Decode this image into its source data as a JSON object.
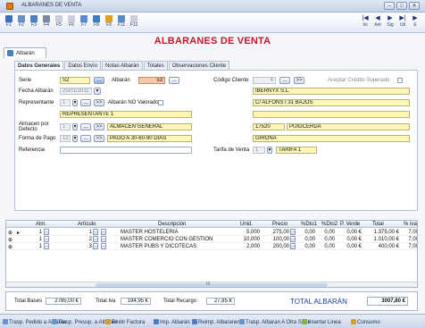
{
  "window": {
    "title": "ALBARANES DE VENTA",
    "controls": [
      "–",
      "□",
      "✕"
    ]
  },
  "toolbar": {
    "buttons": [
      {
        "label": "F1",
        "color": "#3a6fc4",
        "icon": "help-icon"
      },
      {
        "label": "F2",
        "color": "#6b8fc8",
        "icon": "new-document-icon"
      },
      {
        "label": "F3",
        "color": "#4f7ec4",
        "icon": "edit-icon"
      },
      {
        "label": "F4",
        "color": "#7a8aa8",
        "icon": "delete-icon"
      },
      {
        "label": "F5",
        "color": "#c8cfdb",
        "icon": "copy-icon"
      },
      {
        "label": "F6",
        "color": "#c8cfdb",
        "icon": "paste-icon"
      },
      {
        "label": "F7",
        "color": "#5a8bd0",
        "icon": "save-icon"
      },
      {
        "label": "F8",
        "color": "#3a7fc4",
        "icon": "print-icon"
      },
      {
        "label": "F9",
        "color": "#e0a020",
        "icon": "search-icon"
      },
      {
        "label": "F11",
        "color": "#5c8ac8",
        "icon": "filter-icon"
      },
      {
        "label": "F12",
        "color": "#c8cfdb",
        "icon": "exit-icon"
      }
    ],
    "nav": [
      {
        "glyph": "|◀",
        "label": "Ini"
      },
      {
        "glyph": "◀",
        "label": "Ant"
      },
      {
        "glyph": "▶",
        "label": "Sig"
      },
      {
        "glyph": "▶|",
        "label": "Ult"
      },
      {
        "glyph": "▶",
        "label": "E"
      }
    ]
  },
  "page_title": "ALBARANES DE VENTA",
  "doc_tab": "Albarán",
  "tabs": [
    "Datos Generales",
    "Datos Envío",
    "Notas Albarán",
    "Totales",
    "Observaciones Cliente"
  ],
  "form": {
    "serie_label": "Serie",
    "serie": "S2",
    "serie_btn": "...",
    "albaran_label": "Albarán",
    "albaran": "53",
    "albaran_btn": "...",
    "fecha_label": "Fecha Albarán",
    "fecha": "25/01/2011",
    "representante_label": "Representante",
    "representante": "1",
    "rep_btn": "...",
    "rep_go": ">>",
    "no_valorado_label": "Albarán NO Valorado",
    "representante_name": "REPRESENTANTE 1",
    "almacen_label": "Almacen por Defecto",
    "almacen": "1",
    "almacen_btn": "...",
    "almacen_go": ">>",
    "almacen_name": "ALMACEN GENERAL",
    "forma_pago_label": "Forma de Pago",
    "forma_pago": "12",
    "fp_btn": "...",
    "fp_go": ">>",
    "forma_pago_name": "PAGO A 30-60-90 DIAS",
    "referencia_label": "Referencia",
    "referencia": "",
    "codigo_cliente_label": "Código Cliente",
    "codigo_cliente": "4",
    "cc_btn": "...",
    "cc_go": ">>",
    "credito_label": "Aceptar Crédito Superado",
    "cliente_nombre": "IBERNYX S.L.",
    "cliente_direccion": "C/ ALFONS I 31 BAJOS",
    "cliente_extra": "",
    "cliente_cp": "17520",
    "cliente_poblacion": "PUIGCERDA",
    "cliente_provincia": "GIRONA",
    "tarifa_label": "Tarifa de Venta",
    "tarifa": "1",
    "tarifa_name": "TARIFA 1"
  },
  "grid": {
    "headers": [
      "Alm.",
      "Artículo",
      "Descripción",
      "Unid.",
      "Precio",
      "%Dto1",
      "%Dto2",
      "P. Verde",
      "Total",
      "% Iva"
    ],
    "rows": [
      {
        "alm": "1",
        "articulo": "1",
        "descripcion": "MASTER HOSTELERIA",
        "unid": "5,000",
        "precio": "275,00 €",
        "dto1": "0,00",
        "dto2": "0,00",
        "pverde": "0,00 €",
        "total": "1.375,00 €",
        "iva": "7,00"
      },
      {
        "alm": "1",
        "articulo": "2",
        "descripcion": "MASTER COMERCIO CON GESTION",
        "unid": "10,000",
        "precio": "100,00 €",
        "dto1": "0,00",
        "dto2": "0,00",
        "pverde": "0,00 €",
        "total": "1.010,00 €",
        "iva": "7,00"
      },
      {
        "alm": "1",
        "articulo": "3",
        "descripcion": "MASTER PUBS Y DICOTECAS",
        "unid": "2,000",
        "precio": "200,00 €",
        "dto1": "0,00",
        "dto2": "0,00",
        "pverde": "0,00 €",
        "total": "400,00 €",
        "iva": "7,00"
      }
    ],
    "scroll_marker": "III"
  },
  "totals": {
    "bases_label": "Total Bases",
    "bases": "2785,00 €",
    "iva_label": "Total Iva",
    "iva": "194,95 €",
    "recargo_label": "Total Recargo",
    "recargo": "27,85 €",
    "albaran_label": "TOTAL ALBARÁN",
    "albaran": "3007,80 €"
  },
  "statusbar": [
    "Trasp. Pedido a Albarán",
    "Trasp. Presup. a Albarán",
    "Emitir Factura",
    "Imp. Albarán",
    "Reimp. Albaranes",
    "Trasp. Albaran A Otra Serie",
    "Insertar Linea",
    "Consumo"
  ],
  "colors": {
    "title_red": "#c0182a",
    "field_yellow": "#fdf7b8",
    "accent_orange": "#f0b030",
    "total_blue": "#1b3ea0"
  }
}
